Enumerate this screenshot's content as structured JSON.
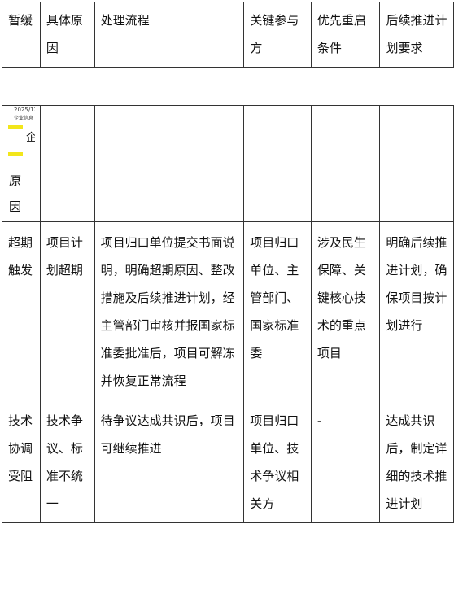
{
  "header": {
    "columns": [
      "暂缓",
      "具体原因",
      "处理流程",
      "关键参与方",
      "优先重启条件",
      "后续推进计划要求"
    ]
  },
  "artifact": {
    "date": "2025/12",
    "subtitle": "企业信息",
    "title_fragment": "企",
    "label": "原因"
  },
  "rows": [
    {
      "trigger": "超期触发",
      "reason": "项目计划超期",
      "process": "项目归口单位提交书面说明，明确超期原因、整改措施及后续推进计划，经主管部门审核并报国家标准委批准后，项目可解冻并恢复正常流程",
      "parties": "项目归口单位、主管部门、国家标准委",
      "restart_condition": "涉及民生保障、关键核心技术的重点项目",
      "follow_up": "明确后续推进计划，确保项目按计划进行"
    },
    {
      "trigger": "技术协调受阻",
      "reason": "技术争议、标准不统一",
      "process": "待争议达成共识后，项目可继续推进",
      "parties": "项目归口单位、技术争议相关方",
      "restart_condition": "-",
      "follow_up": "达成共识后，制定详细的技术推进计划"
    }
  ]
}
